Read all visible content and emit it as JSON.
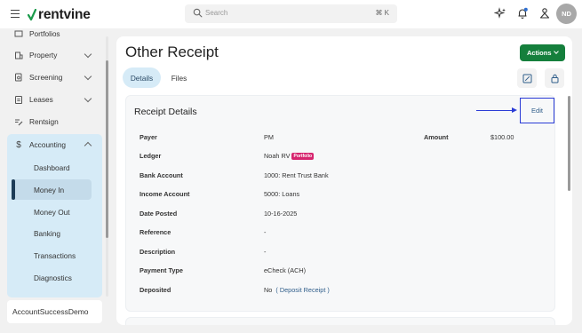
{
  "header": {
    "brand": "rentvine",
    "search_placeholder": "Search",
    "search_shortcut": "⌘ K",
    "avatar_initials": "ND"
  },
  "sidebar": {
    "partial_item": "Portfolios",
    "items": [
      {
        "label": "Property",
        "icon": "building-icon",
        "expandable": true
      },
      {
        "label": "Screening",
        "icon": "document-search-icon",
        "expandable": true
      },
      {
        "label": "Leases",
        "icon": "clipboard-icon",
        "expandable": true
      },
      {
        "label": "Rentsign",
        "icon": "signature-icon",
        "expandable": false
      },
      {
        "label": "Accounting",
        "icon": "dollar-icon",
        "expandable": true,
        "expanded": true
      }
    ],
    "accounting_subitems": [
      "Dashboard",
      "Money In",
      "Money Out",
      "Banking",
      "Transactions",
      "Diagnostics"
    ],
    "active_subitem": "Money In",
    "company": "AccountSuccessDemo"
  },
  "main": {
    "title": "Other Receipt",
    "actions_label": "Actions",
    "tabs": [
      "Details",
      "Files"
    ],
    "active_tab": "Details",
    "card": {
      "title": "Receipt Details",
      "edit_label": "Edit",
      "fields": {
        "payer_label": "Payer",
        "payer_value": "PM",
        "amount_label": "Amount",
        "amount_value": "$100.00",
        "ledger_label": "Ledger",
        "ledger_value": "Noah RV",
        "ledger_badge": "Portfolio",
        "bank_label": "Bank Account",
        "bank_value": "1000: Rent Trust Bank",
        "income_label": "Income Account",
        "income_value": "5000: Loans",
        "date_label": "Date Posted",
        "date_value": "10-16-2025",
        "reference_label": "Reference",
        "reference_value": "-",
        "description_label": "Description",
        "description_value": "-",
        "payment_type_label": "Payment Type",
        "payment_type_value": "eCheck (ACH)",
        "deposited_label": "Deposited",
        "deposited_value": "No",
        "deposit_link": "Deposit Receipt"
      }
    }
  },
  "colors": {
    "brand_green": "#157f3c",
    "sidebar_active_bg": "#d6ebf7",
    "annotation_blue": "#2a3bd6",
    "badge_pink": "#d6246e"
  }
}
